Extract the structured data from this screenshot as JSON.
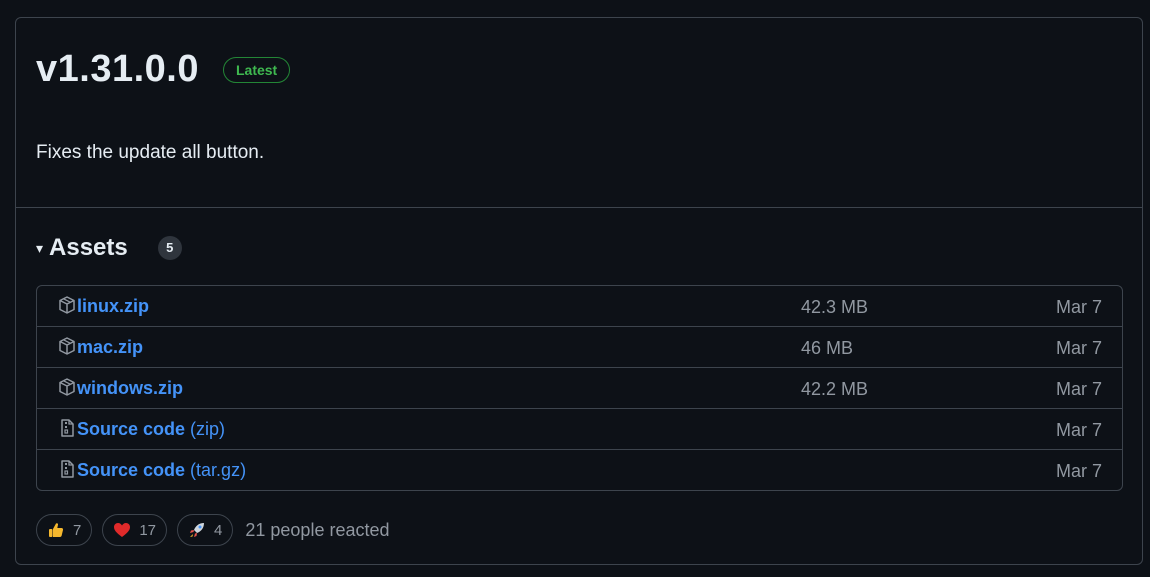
{
  "release": {
    "title": "v1.31.0.0",
    "badge": "Latest",
    "body": "Fixes the update all button."
  },
  "assets": {
    "caret": "▾",
    "title": "Assets",
    "count": "5",
    "items": [
      {
        "icon": "package-icon",
        "name": "linux.zip",
        "suffix": "",
        "size": "42.3 MB",
        "date": "Mar 7"
      },
      {
        "icon": "package-icon",
        "name": "mac.zip",
        "suffix": "",
        "size": "46 MB",
        "date": "Mar 7"
      },
      {
        "icon": "package-icon",
        "name": "windows.zip",
        "suffix": "",
        "size": "42.2 MB",
        "date": "Mar 7"
      },
      {
        "icon": "file-zip-icon",
        "name": "Source code",
        "suffix": " (zip)",
        "size": "",
        "date": "Mar 7"
      },
      {
        "icon": "file-zip-icon",
        "name": "Source code",
        "suffix": " (tar.gz)",
        "size": "",
        "date": "Mar 7"
      }
    ]
  },
  "reactions": {
    "items": [
      {
        "icon": "thumbs-up-icon",
        "count": "7"
      },
      {
        "icon": "heart-icon",
        "count": "17"
      },
      {
        "icon": "rocket-icon",
        "count": "4"
      }
    ],
    "summary": "21 people reacted"
  },
  "colors": {
    "background": "#0d1117",
    "border": "#3d444d",
    "link": "#4493f8",
    "muted": "#9198a1",
    "success": "#3fb950"
  }
}
